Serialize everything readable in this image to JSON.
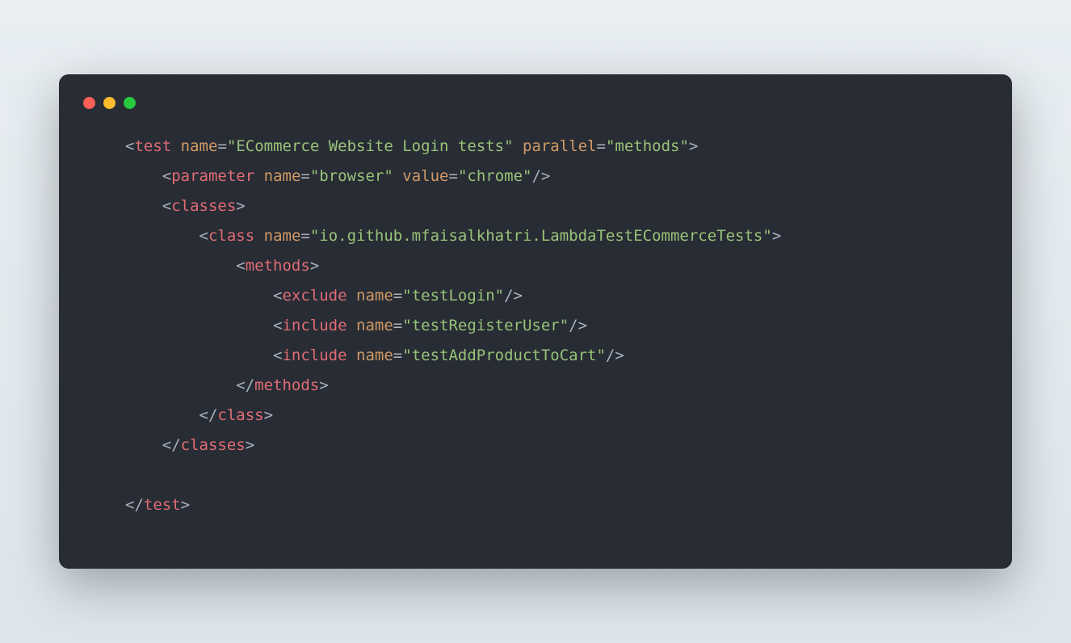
{
  "code": {
    "line1": {
      "p1": "<",
      "tag": "test",
      "sp1": " ",
      "attr1": "name",
      "eq1": "=",
      "q1": "\"",
      "val1": "ECommerce Website Login tests",
      "q2": "\"",
      "sp2": " ",
      "attr2": "parallel",
      "eq2": "=",
      "q3": "\"",
      "val2": "methods",
      "q4": "\"",
      "p2": ">"
    },
    "line2": {
      "indent": "    ",
      "p1": "<",
      "tag": "parameter",
      "sp1": " ",
      "attr1": "name",
      "eq1": "=",
      "q1": "\"",
      "val1": "browser",
      "q2": "\"",
      "sp2": " ",
      "attr2": "value",
      "eq2": "=",
      "q3": "\"",
      "val2": "chrome",
      "q4": "\"",
      "p2": "/>"
    },
    "line3": {
      "indent": "    ",
      "p1": "<",
      "tag": "classes",
      "p2": ">"
    },
    "line4": {
      "indent": "        ",
      "p1": "<",
      "tag": "class",
      "sp1": " ",
      "attr1": "name",
      "eq1": "=",
      "q1": "\"",
      "val1": "io.github.mfaisalkhatri.LambdaTestECommerceTests",
      "q2": "\"",
      "p2": ">"
    },
    "line5": {
      "indent": "            ",
      "p1": "<",
      "tag": "methods",
      "p2": ">"
    },
    "line6": {
      "indent": "                ",
      "p1": "<",
      "tag": "exclude",
      "sp1": " ",
      "attr1": "name",
      "eq1": "=",
      "q1": "\"",
      "val1": "testLogin",
      "q2": "\"",
      "p2": "/>"
    },
    "line7": {
      "indent": "                ",
      "p1": "<",
      "tag": "include",
      "sp1": " ",
      "attr1": "name",
      "eq1": "=",
      "q1": "\"",
      "val1": "testRegisterUser",
      "q2": "\"",
      "p2": "/>"
    },
    "line8": {
      "indent": "                ",
      "p1": "<",
      "tag": "include",
      "sp1": " ",
      "attr1": "name",
      "eq1": "=",
      "q1": "\"",
      "val1": "testAddProductToCart",
      "q2": "\"",
      "p2": "/>"
    },
    "line9": {
      "indent": "            ",
      "p1": "</",
      "tag": "methods",
      "p2": ">"
    },
    "line10": {
      "indent": "        ",
      "p1": "</",
      "tag": "class",
      "p2": ">"
    },
    "line11": {
      "indent": "    ",
      "p1": "</",
      "tag": "classes",
      "p2": ">"
    },
    "line12": {
      "blank": ""
    },
    "line13": {
      "p1": "</",
      "tag": "test",
      "p2": ">"
    }
  }
}
